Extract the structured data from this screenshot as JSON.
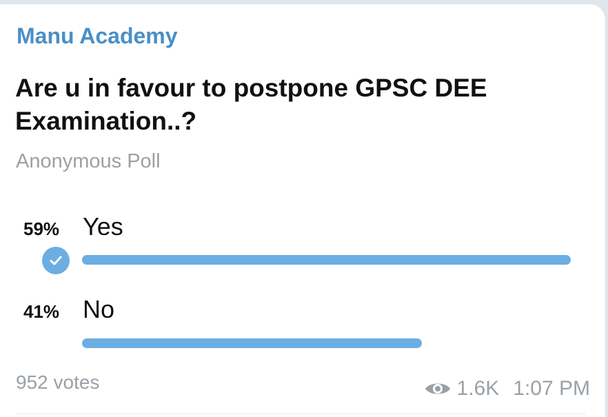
{
  "message": {
    "channel_name": "Manu Academy",
    "poll": {
      "question": "Are u in favour to postpone GPSC DEE Examination..?",
      "type_label": "Anonymous Poll",
      "options": [
        {
          "percent": "59%",
          "label": "Yes",
          "share": 0.59,
          "selected": true
        },
        {
          "percent": "41%",
          "label": "No",
          "share": 0.41,
          "selected": false
        }
      ],
      "votes": "952 votes"
    },
    "views": "1.6K",
    "time": "1:07 PM"
  },
  "colors": {
    "accent": "#6caee2",
    "channel_name": "#4a8fc6",
    "muted_text": "#9aa1a6"
  },
  "icons": {
    "selected_option": "check-icon",
    "views": "eye-icon"
  }
}
